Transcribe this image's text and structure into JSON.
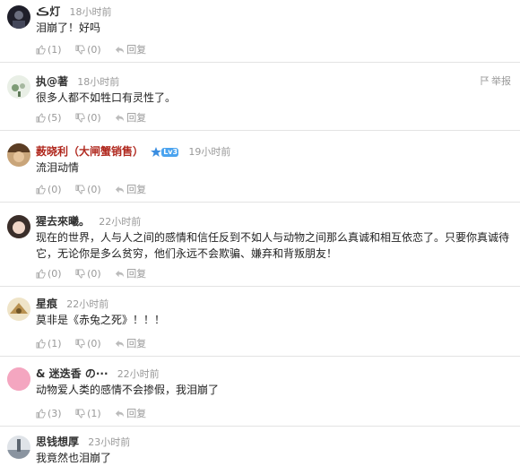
{
  "comments": [
    {
      "user": "ڪ灯",
      "time": "18小时前",
      "text": "泪崩了！好吗",
      "up": "(1)",
      "down": "(0)",
      "reply": "回复"
    },
    {
      "user": "执@著",
      "time": "18小时前",
      "text": "很多人都不如牲口有灵性了。",
      "up": "(5)",
      "down": "(0)",
      "reply": "回复",
      "report": "举报"
    },
    {
      "user": "薮晓利（大闸蟹销售）",
      "time": "19小时前",
      "text": "流泪动情",
      "up": "(0)",
      "down": "(0)",
      "reply": "回复"
    },
    {
      "user": "猩去來曦。",
      "time": "22小时前",
      "text": "现在的世界，人与人之间的感情和信任反到不如人与动物之间那么真诚和相互依恋了。只要你真诚待它，无论你是多么贫穷，他们永远不会欺骗、嫌弃和背叛朋友！",
      "up": "(0)",
      "down": "(0)",
      "reply": "回复"
    },
    {
      "user": "星痕",
      "time": "22小时前",
      "text": "莫非是《赤兔之死》！！！",
      "up": "(1)",
      "down": "(0)",
      "reply": "回复"
    },
    {
      "user": "& 迷迭香 の···",
      "time": "22小时前",
      "text": "动物爱人类的感情不会掺假，我泪崩了",
      "up": "(3)",
      "down": "(1)",
      "reply": "回复"
    },
    {
      "user": "思钱想厚",
      "time": "23小时前",
      "text": "我竟然也泪崩了",
      "up": "",
      "down": "",
      "reply": ""
    }
  ],
  "badge_text": "Lv3",
  "colors": {
    "username_red": "#b0281e",
    "meta_gray": "#999999",
    "divider": "#e3e3e3"
  }
}
